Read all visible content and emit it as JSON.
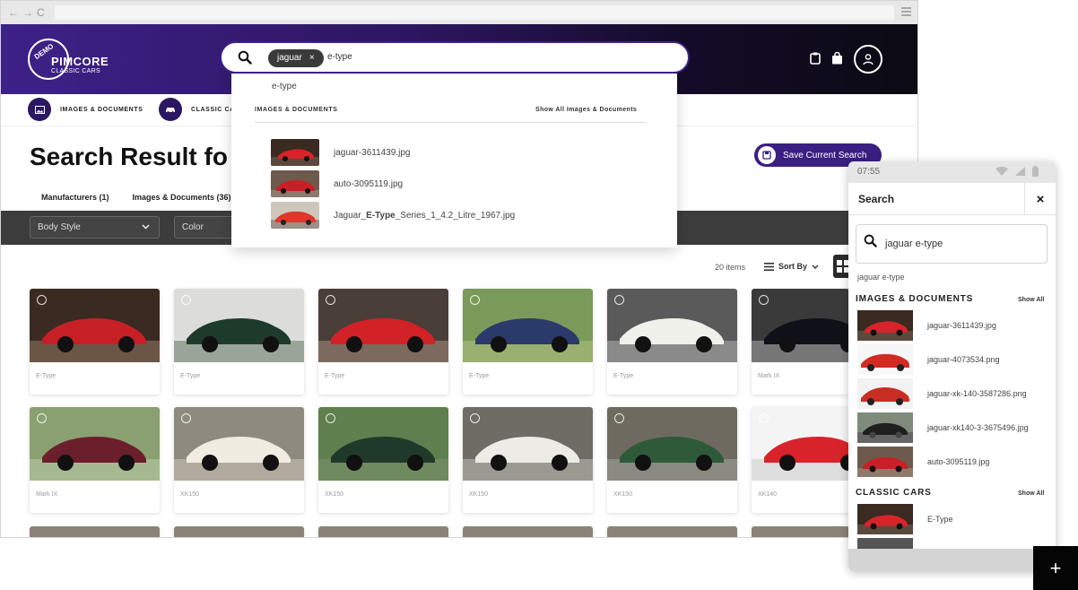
{
  "browser": {
    "nav": {
      "back": "←",
      "forward": "→",
      "reload": "C"
    }
  },
  "header": {
    "logo": {
      "badge": "DEMO",
      "name": "PIMCORE",
      "subtitle": "CLASSIC CARS"
    },
    "icons": [
      "clipboard-icon",
      "bag-icon",
      "user-icon"
    ]
  },
  "search": {
    "chip": "jaguar",
    "chip_remove": "×",
    "query": "e-type"
  },
  "categories": [
    {
      "label": "IMAGES & DOCUMENTS",
      "icon": "image-icon"
    },
    {
      "label": "CLASSIC CA",
      "icon": "car-icon"
    }
  ],
  "main": {
    "title": "Search Result fo",
    "save_search": "Save Current Search",
    "tabs": [
      "Manufacturers (1)",
      "Images & Documents (36)"
    ],
    "filters": [
      "Body Style",
      "Color"
    ],
    "items_count": "20 items",
    "sort_by": "Sort By"
  },
  "dropdown": {
    "suggestion": "e-type",
    "section": "IMAGES & DOCUMENTS",
    "show_all": "Show All Images & Documents",
    "results": [
      {
        "pre": "jaguar-3611439.jpg",
        "bold": "",
        "post": ""
      },
      {
        "pre": "auto-3095119.jpg",
        "bold": "",
        "post": ""
      },
      {
        "pre": "Jaguar_",
        "bold": "E-Type",
        "post": "_Series_1_4.2_Litre_1967.jpg"
      }
    ]
  },
  "cards": [
    "E-Type",
    "E-Type",
    "E-Type",
    "E-Type",
    "E-Type",
    "Mark IX",
    "Mark IX",
    "XK150",
    "XK150",
    "XK150",
    "XK150",
    "XK140"
  ],
  "mobile": {
    "time": "07:55",
    "title": "Search",
    "close": "×",
    "query": "jaguar e-type",
    "suggestion": "jaguar e-type",
    "images_section": "IMAGES & DOCUMENTS",
    "images_show_all": "Show All",
    "images": [
      "jaguar-3611439.jpg",
      "jaguar-4073534.png",
      "jaguar-xk-140-3587286.png",
      "jaguar-xk140-3-3675496.jpg",
      "auto-3095119.jpg"
    ],
    "cars_section": "CLASSIC CARS",
    "cars_show_all": "Show All",
    "cars": [
      "E-Type"
    ]
  },
  "fab": "+",
  "colors": {
    "brand_purple": "#3e2188",
    "dark_bar": "#3c3c3c",
    "accent_button": "#3a1e82"
  }
}
